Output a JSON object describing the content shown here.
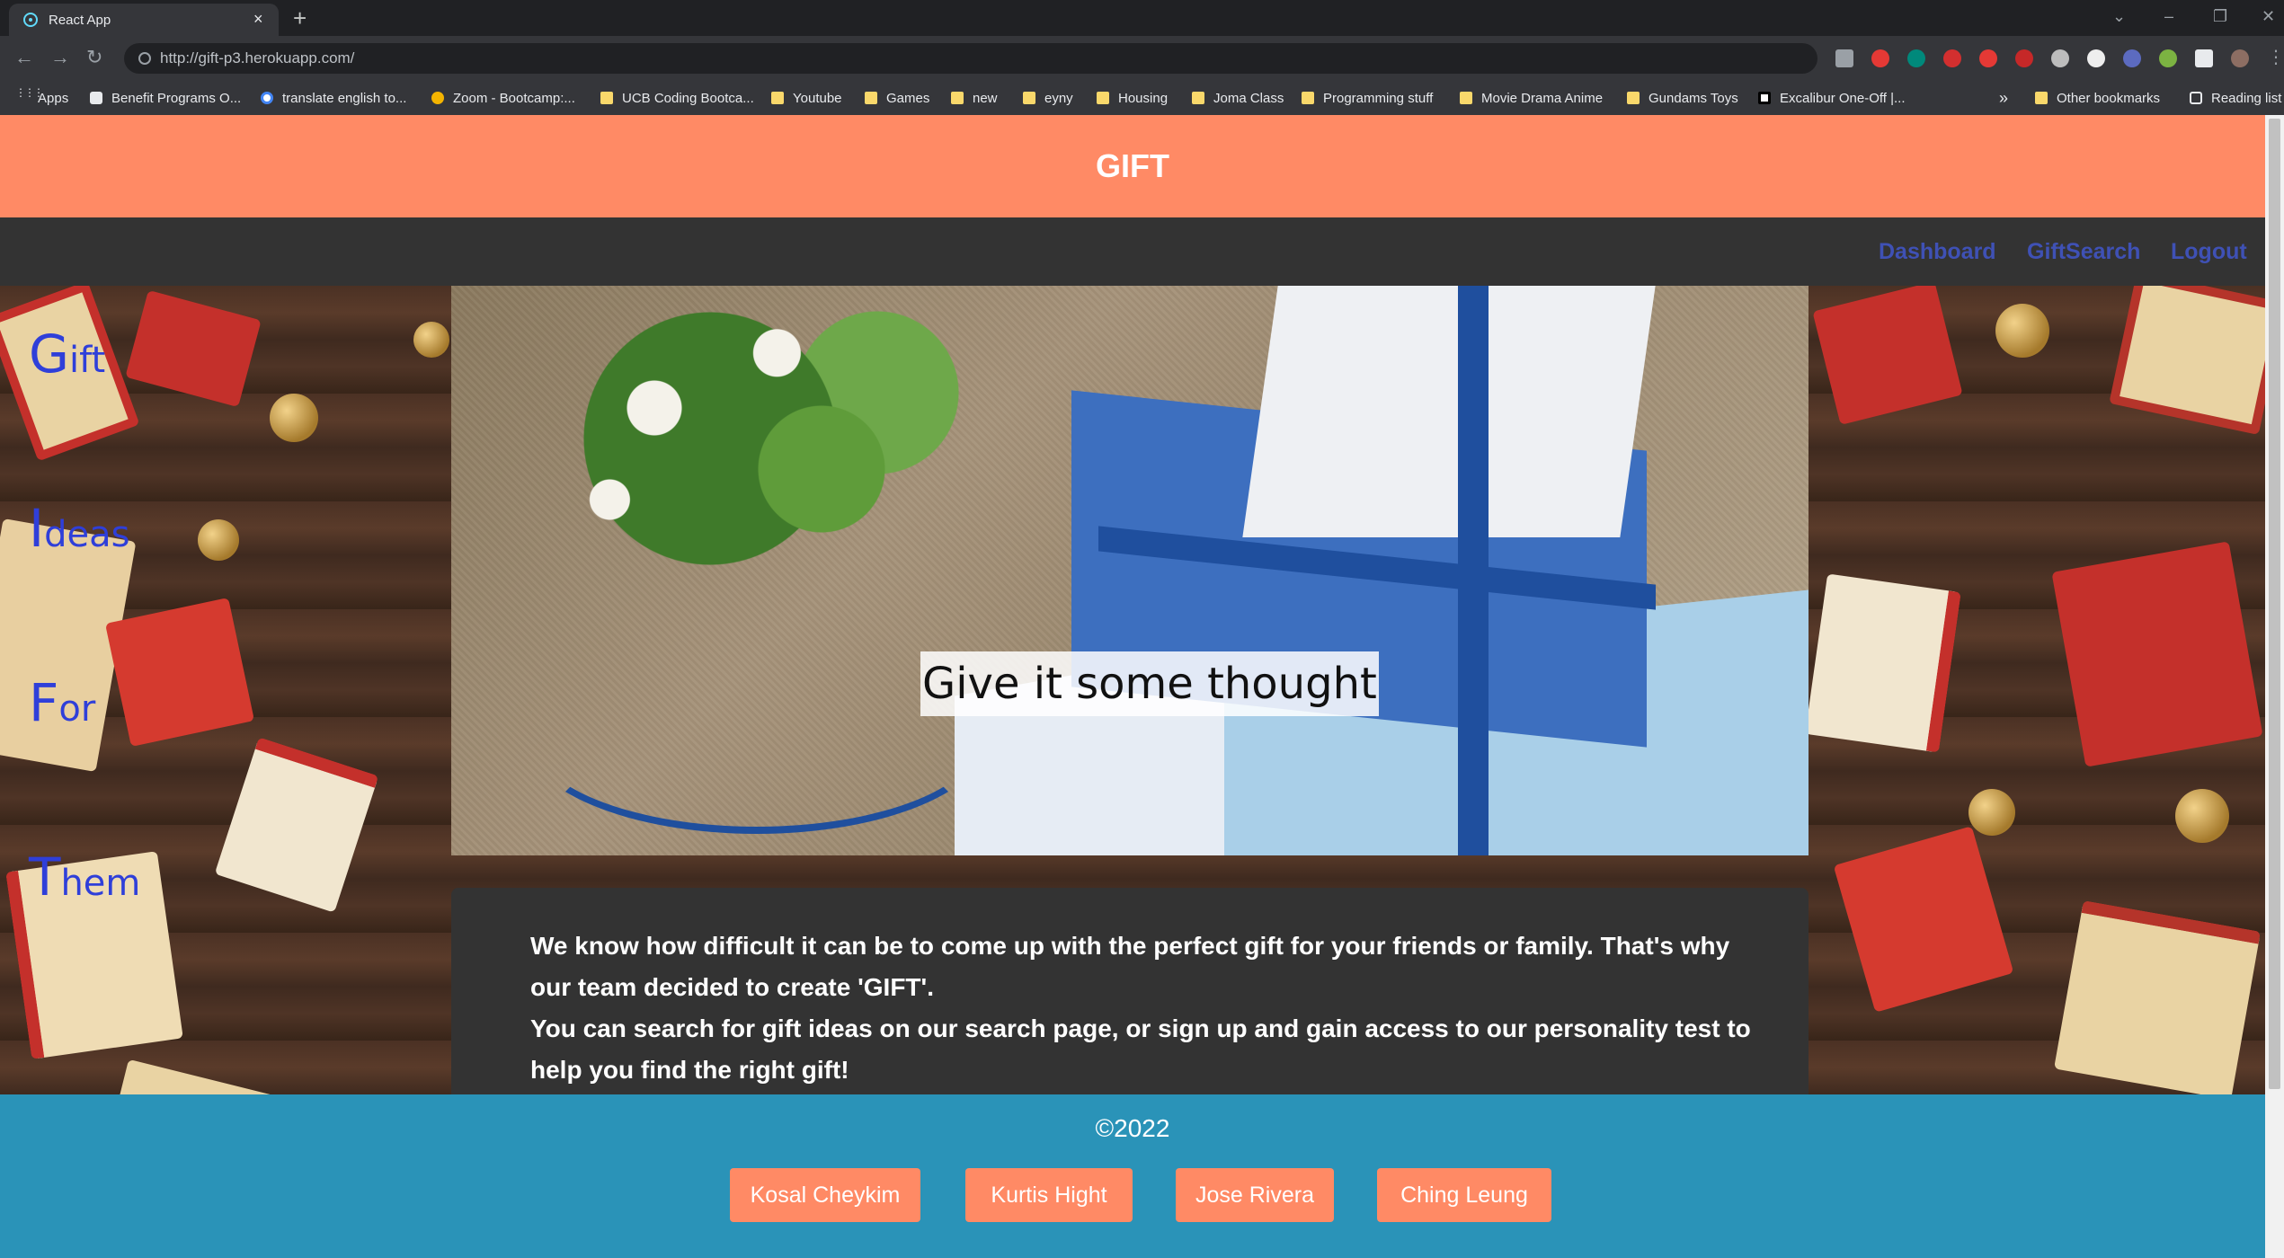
{
  "browser": {
    "tab_title": "React App",
    "tab_close": "×",
    "new_tab": "+",
    "url": "http://gift-p3.herokuapp.com/",
    "bookmarks": [
      "Apps",
      "Benefit Programs O...",
      "translate english to...",
      "Zoom - Bootcamp:...",
      "UCB Coding Bootca...",
      "Youtube",
      "Games",
      "new",
      "eyny",
      "Housing",
      "Joma Class",
      "Programming stuff",
      "Movie Drama Anime",
      "Gundams Toys",
      "Excalibur One-Off |..."
    ],
    "bookmarks_overflow": "»",
    "other_bookmarks": "Other bookmarks",
    "reading_list": "Reading list"
  },
  "header": {
    "title": "GIFT"
  },
  "nav": {
    "dashboard": "Dashboard",
    "gift_search": "GiftSearch",
    "logout": "Logout"
  },
  "side_title": [
    {
      "first": "G",
      "rest": "ift"
    },
    {
      "first": "I",
      "rest": "deas"
    },
    {
      "first": "F",
      "rest": "or"
    },
    {
      "first": "T",
      "rest": "hem"
    }
  ],
  "hero": {
    "caption": "Give it some thought"
  },
  "about": {
    "line1": "We know how difficult it can be to come up with the perfect gift for your friends or family. That's why our team decided to create 'GIFT'.",
    "line2": "You can search for gift ideas on our search page, or sign up and gain access to our personality test to help you find the right gift!"
  },
  "footer": {
    "copyright": "©2022",
    "credits": [
      "Kosal Cheykim",
      "Kurtis Hight",
      "Jose Rivera",
      "Ching Leung"
    ]
  },
  "colors": {
    "header": "#ff8a65",
    "nav_bg": "#333333",
    "nav_link": "#3f51b5",
    "footer": "#2a93b8",
    "side_text": "#2f3fd9"
  }
}
